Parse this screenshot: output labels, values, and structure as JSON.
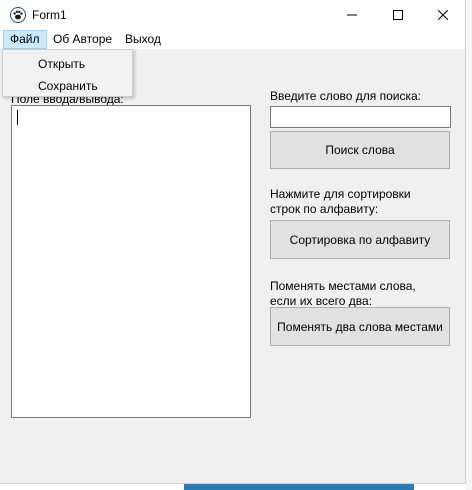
{
  "window": {
    "title": "Form1"
  },
  "menu": {
    "items": [
      "Файл",
      "Об Авторе",
      "Выход"
    ],
    "file_dropdown": [
      "Открыть",
      "Сохранить"
    ]
  },
  "left_panel": {
    "label": "Поле ввода/вывода:"
  },
  "search": {
    "label": "Введите слово для поиска:",
    "value": "",
    "button": "Поиск слова"
  },
  "sort": {
    "label_line1": "Нажмите для сортировки",
    "label_line2": "строк по алфавиту:",
    "button": "Сортировка по алфавиту"
  },
  "swap": {
    "label_line1": "Поменять местами слова,",
    "label_line2": "если их всего два:",
    "button": "Поменять два слова местами"
  },
  "colors": {
    "accent": "#cce8ff",
    "taskbar": "#2e7bb4"
  }
}
